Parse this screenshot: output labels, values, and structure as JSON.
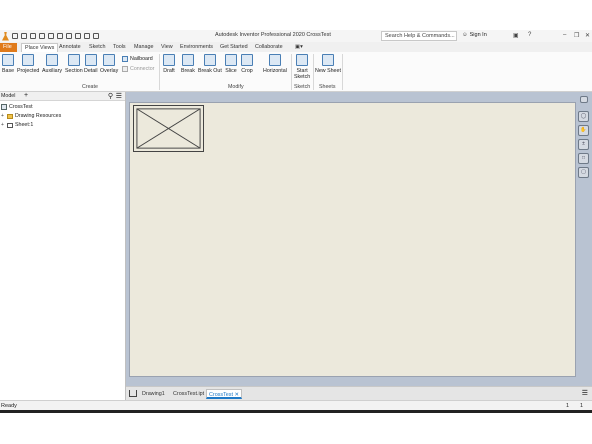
{
  "window": {
    "title": "Autodesk Inventor Professional 2020   CrossTest",
    "search_placeholder": "Search Help & Commands...",
    "sign_in": "Sign In",
    "help": "?"
  },
  "ribbon": {
    "tabs": [
      {
        "label": "File"
      },
      {
        "label": "Place Views"
      },
      {
        "label": "Annotate"
      },
      {
        "label": "Sketch"
      },
      {
        "label": "Tools"
      },
      {
        "label": "Manage"
      },
      {
        "label": "View"
      },
      {
        "label": "Environments"
      },
      {
        "label": "Get Started"
      },
      {
        "label": "Collaborate"
      }
    ],
    "create": {
      "buttons": [
        "Base",
        "Projected",
        "Auxiliary",
        "Section",
        "Detail",
        "Overlay"
      ],
      "nailboard": "Nailboard",
      "connector": "Connector",
      "label": "Create"
    },
    "modify": {
      "buttons": [
        "Draft",
        "Break",
        "Break Out",
        "Slice",
        "Crop",
        "Horizontal"
      ],
      "label": "Modify"
    },
    "sketch": {
      "button_line1": "Start",
      "button_line2": "Sketch",
      "label": "Sketch"
    },
    "sheets": {
      "button": "New Sheet",
      "label": "Sheets"
    }
  },
  "browser": {
    "header": "Model",
    "root": "CrossTest",
    "items": [
      "Drawing Resources",
      "Sheet:1"
    ]
  },
  "doc_tabs": [
    "Drawing1",
    "CrossTest.ipt",
    "CrossTest"
  ],
  "status": {
    "text": "Ready",
    "count1": "1",
    "count2": "1"
  }
}
